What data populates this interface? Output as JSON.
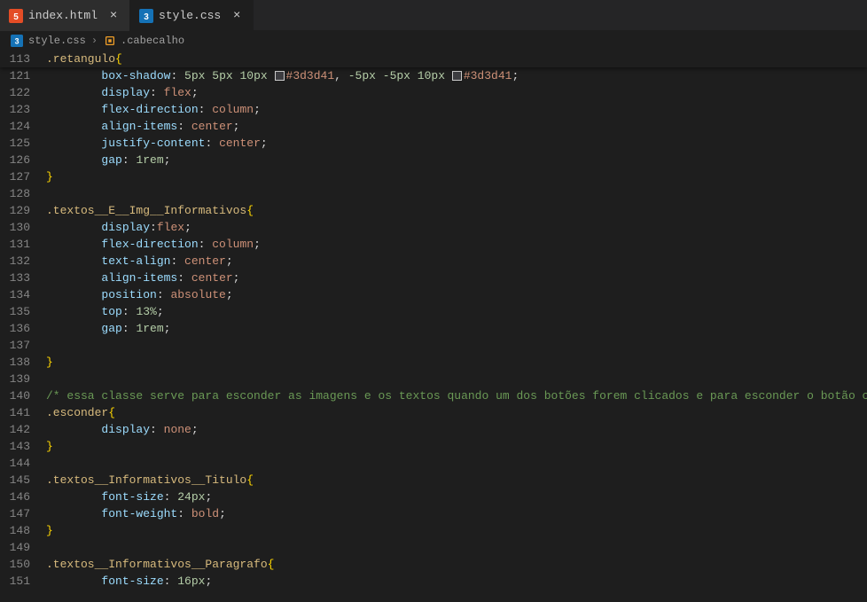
{
  "tabs": [
    {
      "label": "index.html",
      "icon": "html"
    },
    {
      "label": "style.css",
      "icon": "css",
      "active": true
    }
  ],
  "breadcrumb": {
    "file": "style.css",
    "symbol": ".cabecalho"
  },
  "sticky": {
    "lineno": "113",
    "selector": ".retangulo",
    "brace": "{"
  },
  "lines": [
    {
      "n": "121",
      "indent": 2,
      "tokens": [
        [
          "prop",
          "box-shadow"
        ],
        [
          "punc",
          ": "
        ],
        [
          "num",
          "5px"
        ],
        [
          "punc",
          " "
        ],
        [
          "num",
          "5px"
        ],
        [
          "punc",
          " "
        ],
        [
          "num",
          "10px"
        ],
        [
          "punc",
          " "
        ],
        [
          "swatch",
          ""
        ],
        [
          "hex",
          "#3d3d41"
        ],
        [
          "punc",
          ", "
        ],
        [
          "num",
          "-5px"
        ],
        [
          "punc",
          " "
        ],
        [
          "num",
          "-5px"
        ],
        [
          "punc",
          " "
        ],
        [
          "num",
          "10px"
        ],
        [
          "punc",
          " "
        ],
        [
          "swatch",
          ""
        ],
        [
          "hex",
          "#3d3d41"
        ],
        [
          "punc",
          ";"
        ]
      ]
    },
    {
      "n": "122",
      "indent": 2,
      "tokens": [
        [
          "prop",
          "display"
        ],
        [
          "punc",
          ": "
        ],
        [
          "kw",
          "flex"
        ],
        [
          "punc",
          ";"
        ]
      ]
    },
    {
      "n": "123",
      "indent": 2,
      "tokens": [
        [
          "prop",
          "flex-direction"
        ],
        [
          "punc",
          ": "
        ],
        [
          "kw",
          "column"
        ],
        [
          "punc",
          ";"
        ]
      ]
    },
    {
      "n": "124",
      "indent": 2,
      "tokens": [
        [
          "prop",
          "align-items"
        ],
        [
          "punc",
          ": "
        ],
        [
          "kw",
          "center"
        ],
        [
          "punc",
          ";"
        ]
      ]
    },
    {
      "n": "125",
      "indent": 2,
      "tokens": [
        [
          "prop",
          "justify-content"
        ],
        [
          "punc",
          ": "
        ],
        [
          "kw",
          "center"
        ],
        [
          "punc",
          ";"
        ]
      ]
    },
    {
      "n": "126",
      "indent": 2,
      "tokens": [
        [
          "prop",
          "gap"
        ],
        [
          "punc",
          ": "
        ],
        [
          "num",
          "1rem"
        ],
        [
          "punc",
          ";"
        ]
      ]
    },
    {
      "n": "127",
      "indent": 0,
      "tokens": [
        [
          "brace",
          "}"
        ]
      ]
    },
    {
      "n": "128",
      "indent": 0,
      "tokens": []
    },
    {
      "n": "129",
      "indent": 0,
      "tokens": [
        [
          "sel",
          ".textos__E__Img__Informativos"
        ],
        [
          "brace",
          "{"
        ]
      ]
    },
    {
      "n": "130",
      "indent": 2,
      "tokens": [
        [
          "prop",
          "display"
        ],
        [
          "punc",
          ":"
        ],
        [
          "kw",
          "flex"
        ],
        [
          "punc",
          ";"
        ]
      ]
    },
    {
      "n": "131",
      "indent": 2,
      "tokens": [
        [
          "prop",
          "flex-direction"
        ],
        [
          "punc",
          ": "
        ],
        [
          "kw",
          "column"
        ],
        [
          "punc",
          ";"
        ]
      ]
    },
    {
      "n": "132",
      "indent": 2,
      "tokens": [
        [
          "prop",
          "text-align"
        ],
        [
          "punc",
          ": "
        ],
        [
          "kw",
          "center"
        ],
        [
          "punc",
          ";"
        ]
      ]
    },
    {
      "n": "133",
      "indent": 2,
      "tokens": [
        [
          "prop",
          "align-items"
        ],
        [
          "punc",
          ": "
        ],
        [
          "kw",
          "center"
        ],
        [
          "punc",
          ";"
        ]
      ]
    },
    {
      "n": "134",
      "indent": 2,
      "tokens": [
        [
          "prop",
          "position"
        ],
        [
          "punc",
          ": "
        ],
        [
          "kw",
          "absolute"
        ],
        [
          "punc",
          ";"
        ]
      ]
    },
    {
      "n": "135",
      "indent": 2,
      "tokens": [
        [
          "prop",
          "top"
        ],
        [
          "punc",
          ": "
        ],
        [
          "num",
          "13%"
        ],
        [
          "punc",
          ";"
        ]
      ]
    },
    {
      "n": "136",
      "indent": 2,
      "tokens": [
        [
          "prop",
          "gap"
        ],
        [
          "punc",
          ": "
        ],
        [
          "num",
          "1rem"
        ],
        [
          "punc",
          ";"
        ]
      ]
    },
    {
      "n": "137",
      "indent": 0,
      "tokens": []
    },
    {
      "n": "138",
      "indent": 0,
      "tokens": [
        [
          "brace",
          "}"
        ]
      ]
    },
    {
      "n": "139",
      "indent": 0,
      "tokens": []
    },
    {
      "n": "140",
      "indent": 0,
      "tokens": [
        [
          "comment",
          "/* essa classe serve para esconder as imagens e os textos quando um dos botões forem clicados e para esconder o botão c"
        ]
      ]
    },
    {
      "n": "141",
      "indent": 0,
      "tokens": [
        [
          "sel",
          ".esconder"
        ],
        [
          "brace",
          "{"
        ]
      ]
    },
    {
      "n": "142",
      "indent": 2,
      "tokens": [
        [
          "prop",
          "display"
        ],
        [
          "punc",
          ": "
        ],
        [
          "kw",
          "none"
        ],
        [
          "punc",
          ";"
        ]
      ]
    },
    {
      "n": "143",
      "indent": 0,
      "tokens": [
        [
          "brace",
          "}"
        ]
      ]
    },
    {
      "n": "144",
      "indent": 0,
      "tokens": []
    },
    {
      "n": "145",
      "indent": 0,
      "tokens": [
        [
          "sel",
          ".textos__Informativos__Titulo"
        ],
        [
          "brace",
          "{"
        ]
      ]
    },
    {
      "n": "146",
      "indent": 2,
      "tokens": [
        [
          "prop",
          "font-size"
        ],
        [
          "punc",
          ": "
        ],
        [
          "num",
          "24px"
        ],
        [
          "punc",
          ";"
        ]
      ]
    },
    {
      "n": "147",
      "indent": 2,
      "tokens": [
        [
          "prop",
          "font-weight"
        ],
        [
          "punc",
          ": "
        ],
        [
          "kw",
          "bold"
        ],
        [
          "punc",
          ";"
        ]
      ]
    },
    {
      "n": "148",
      "indent": 0,
      "tokens": [
        [
          "brace",
          "}"
        ]
      ]
    },
    {
      "n": "149",
      "indent": 0,
      "tokens": []
    },
    {
      "n": "150",
      "indent": 0,
      "tokens": [
        [
          "sel",
          ".textos__Informativos__Paragrafo"
        ],
        [
          "brace",
          "{"
        ]
      ]
    },
    {
      "n": "151",
      "indent": 2,
      "tokens": [
        [
          "prop",
          "font-size"
        ],
        [
          "punc",
          ": "
        ],
        [
          "num",
          "16px"
        ],
        [
          "punc",
          ";"
        ]
      ]
    }
  ]
}
